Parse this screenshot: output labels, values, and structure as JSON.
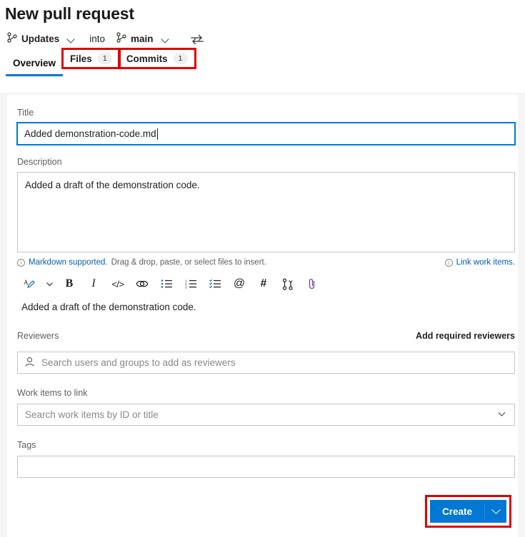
{
  "header": {
    "title": "New pull request",
    "source_branch": "Updates",
    "into_label": "into",
    "target_branch": "main",
    "swap_icon": "swap-branches-icon",
    "branch_icon": "branch-icon"
  },
  "tabs": [
    {
      "label": "Overview",
      "badge": null,
      "active": true,
      "highlighted": false
    },
    {
      "label": "Files",
      "badge": "1",
      "active": false,
      "highlighted": true
    },
    {
      "label": "Commits",
      "badge": "1",
      "active": false,
      "highlighted": true
    }
  ],
  "form": {
    "title_label": "Title",
    "title_value": "Added demonstration-code.md",
    "description_label": "Description",
    "description_value": "Added a draft of the demonstration code.",
    "markdown_link": "Markdown supported.",
    "markdown_hint": "Drag & drop, paste, or select files to insert.",
    "link_work_items": "Link work items.",
    "preview_text": "Added a draft of the demonstration code.",
    "reviewers_label": "Reviewers",
    "add_required_reviewers": "Add required reviewers",
    "reviewers_placeholder": "Search users and groups to add as reviewers",
    "work_items_label": "Work items to link",
    "work_items_placeholder": "Search work items by ID or title",
    "tags_label": "Tags",
    "tags_value": ""
  },
  "toolbar": {
    "items": [
      {
        "name": "font-color-icon",
        "glyph": "A"
      },
      {
        "name": "chevron-down-icon",
        "glyph": "v"
      },
      {
        "name": "bold-icon",
        "glyph": "B"
      },
      {
        "name": "italic-icon",
        "glyph": "I"
      },
      {
        "name": "code-icon",
        "glyph": "</>"
      },
      {
        "name": "link-icon",
        "glyph": "link"
      },
      {
        "name": "bulleted-list-icon",
        "glyph": "list"
      },
      {
        "name": "numbered-list-icon",
        "glyph": "olist"
      },
      {
        "name": "task-list-icon",
        "glyph": "tlist"
      },
      {
        "name": "mention-icon",
        "glyph": "@"
      },
      {
        "name": "work-item-icon",
        "glyph": "#"
      },
      {
        "name": "pull-request-icon",
        "glyph": "pr"
      },
      {
        "name": "attach-icon",
        "glyph": "clip"
      }
    ]
  },
  "actions": {
    "create_label": "Create",
    "create_dropdown_icon": "chevron-down-icon"
  },
  "colors": {
    "accent": "#0078d4",
    "highlight_box": "#e00000",
    "link": "#0061ab",
    "page_bg": "#f5f5f5",
    "border": "#c8c6c4"
  }
}
